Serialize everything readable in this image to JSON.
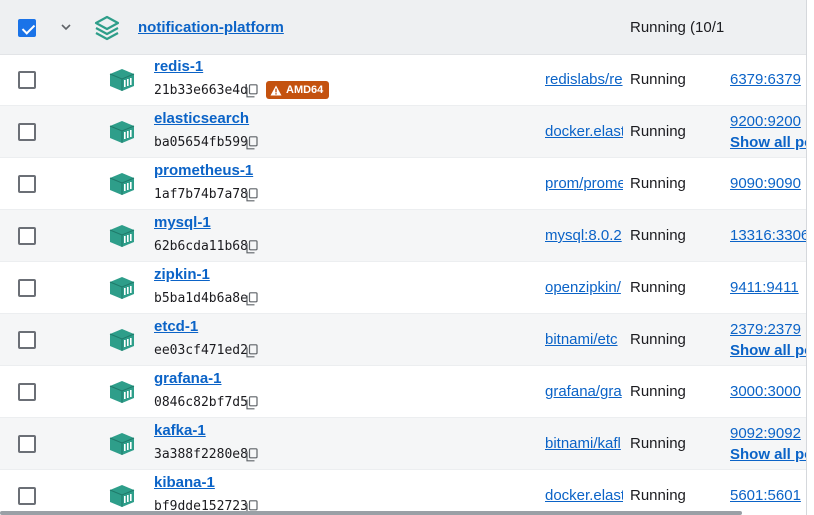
{
  "group": {
    "name": "notification-platform",
    "status": "Running (10/1",
    "checked": true
  },
  "containers": [
    {
      "name": "redis-1",
      "id": "21b33e663e4d",
      "badge": "AMD64",
      "image": "redislabs/re",
      "status": "Running",
      "port": "6379:6379",
      "port_more": "",
      "show_all": ""
    },
    {
      "name": "elasticsearch",
      "id": "ba05654fb599",
      "badge": "",
      "image": "docker.elast",
      "status": "Running",
      "port": "9200:9200",
      "port_more": "",
      "show_all": "Show all po"
    },
    {
      "name": "prometheus-1",
      "id": "1af7b74b7a78",
      "badge": "",
      "image": "prom/prome",
      "status": "Running",
      "port": "9090:9090",
      "port_more": "",
      "show_all": ""
    },
    {
      "name": "mysql-1",
      "id": "62b6cda11b68",
      "badge": "",
      "image": "mysql:8.0.2",
      "status": "Running",
      "port": "13316:3306",
      "port_more": "",
      "show_all": ""
    },
    {
      "name": "zipkin-1",
      "id": "b5ba1d4b6a8e",
      "badge": "",
      "image": "openzipkin/",
      "status": "Running",
      "port": "9411:9411",
      "port_more": "",
      "show_all": ""
    },
    {
      "name": "etcd-1",
      "id": "ee03cf471ed2",
      "badge": "",
      "image": "bitnami/etc",
      "status": "Running",
      "port": "2379:2379",
      "port_more": "",
      "show_all": "Show all po"
    },
    {
      "name": "grafana-1",
      "id": "0846c82bf7d5",
      "badge": "",
      "image": "grafana/gra",
      "status": "Running",
      "port": "3000:3000",
      "port_more": "",
      "show_all": ""
    },
    {
      "name": "kafka-1",
      "id": "3a388f2280e8",
      "badge": "",
      "image": "bitnami/kafl",
      "status": "Running",
      "port": "9092:9092",
      "port_more": "",
      "show_all": "Show all po"
    },
    {
      "name": "kibana-1",
      "id": "bf9dde152723",
      "badge": "",
      "image": "docker.elast",
      "status": "Running",
      "port": "5601:5601",
      "port_more": "",
      "show_all": ""
    }
  ],
  "icons": {
    "group": "stack-layers-icon",
    "container": "container-cube-icon",
    "copy": "copy-icon",
    "warning": "warning-icon",
    "expand": "chevron-down-icon"
  },
  "colors": {
    "link": "#0b63c7",
    "container_icon": "#2e9e8a",
    "badge": "#c4520f",
    "checkbox_checked": "#1a73e8"
  }
}
